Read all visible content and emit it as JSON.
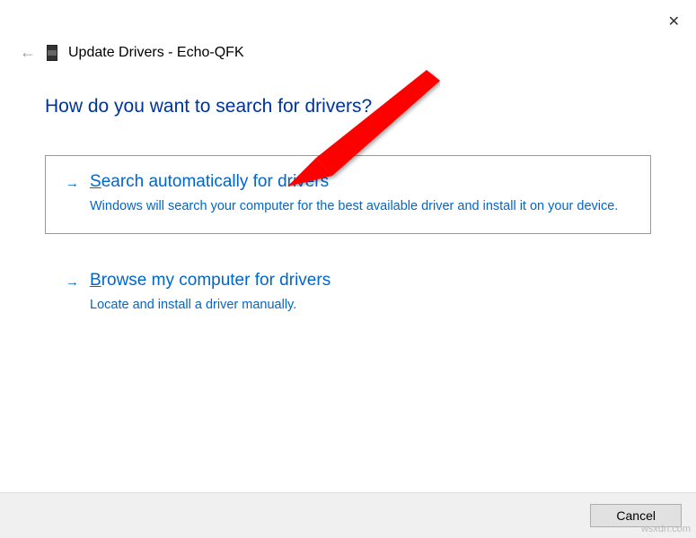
{
  "window": {
    "title": "Update Drivers - Echo-QFK"
  },
  "heading": "How do you want to search for drivers?",
  "options": {
    "auto": {
      "title_prefix": "S",
      "title_rest": "earch automatically for drivers",
      "description": "Windows will search your computer for the best available driver and install it on your device."
    },
    "browse": {
      "title_prefix": "B",
      "title_rest": "rowse my computer for drivers",
      "description": "Locate and install a driver manually."
    }
  },
  "footer": {
    "cancel_label": "Cancel"
  },
  "watermark": "wsxdn.com"
}
